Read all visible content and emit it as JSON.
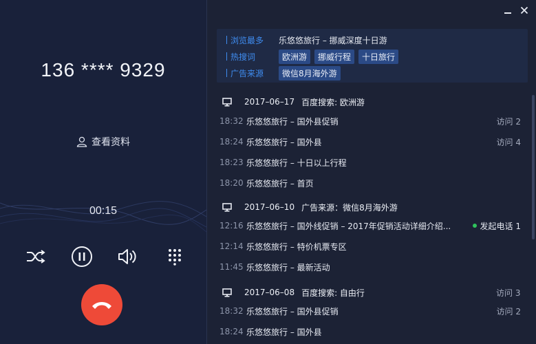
{
  "call": {
    "phone": "136 **** 9329",
    "profile_label": "查看资料",
    "timer": "00:15"
  },
  "controls": [
    "shuffle-icon",
    "pause-icon",
    "volume-icon",
    "keypad-icon"
  ],
  "colors": {
    "hangup": "#ee4a38",
    "accent": "#3f8cf0",
    "tag_bg": "#2b4a86",
    "online_dot": "#2fc35c"
  },
  "summary": {
    "most_viewed_label": "浏览最多",
    "most_viewed_value": "乐悠悠旅行 – 挪威深度十日游",
    "hot_words_label": "热搜词",
    "hot_words": [
      "欧洲游",
      "挪威行程",
      "十日旅行"
    ],
    "ad_source_label": "广告来源",
    "ad_source": "微信8月海外游"
  },
  "history": [
    {
      "date": "2017–06–17",
      "source": "百度搜索: 欧洲游",
      "entries": [
        {
          "time": "18:32",
          "title": "乐悠悠旅行 – 国外县促销",
          "meta": "访问 2"
        },
        {
          "time": "18:24",
          "title": "乐悠悠旅行 – 国外县",
          "meta": "访问 4"
        },
        {
          "time": "18:23",
          "title": "乐悠悠旅行 – 十日以上行程",
          "meta": ""
        },
        {
          "time": "18:20",
          "title": "乐悠悠旅行 – 首页",
          "meta": ""
        }
      ]
    },
    {
      "date": "2017–06–10",
      "source": "广告来源：微信8月海外游",
      "entries": [
        {
          "time": "12:16",
          "title": "乐悠悠旅行 – 国外线促销 – 2017年促销活动详细介绍...",
          "meta": "发起电话 1"
        },
        {
          "time": "12:14",
          "title": "乐悠悠旅行 – 特价机票专区",
          "meta": ""
        },
        {
          "time": "11:45",
          "title": "乐悠悠旅行 – 最新活动",
          "meta": ""
        }
      ]
    },
    {
      "date": "2017–06–08",
      "source": "百度搜索: 自由行",
      "entries": [
        {
          "time": "18:32",
          "title": "乐悠悠旅行 – 国外县促销",
          "meta": "访问 3"
        },
        {
          "time": "18:32",
          "title": "乐悠悠旅行 – 国外县促销",
          "meta": "访问 2"
        },
        {
          "time": "18:24",
          "title": "乐悠悠旅行 – 国外县",
          "meta": ""
        }
      ]
    }
  ]
}
